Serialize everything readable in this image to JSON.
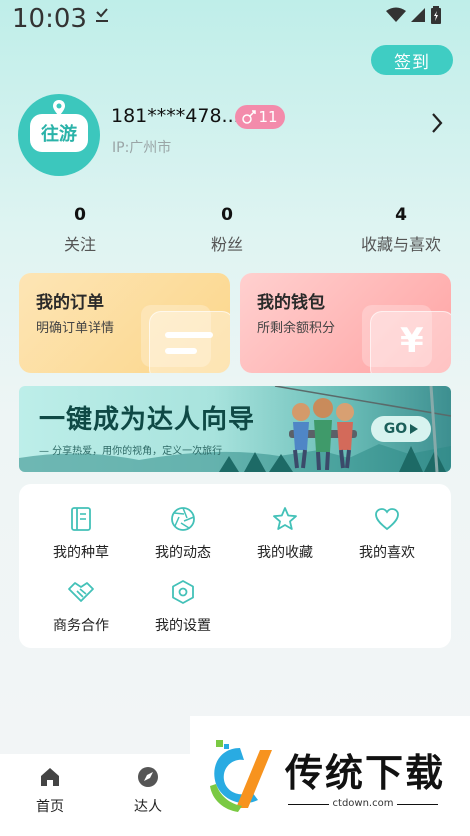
{
  "status_bar": {
    "time": "10:03"
  },
  "header": {
    "signin_label": "签到"
  },
  "profile": {
    "avatar_text": "往游",
    "phone": "181****478...",
    "level": "11",
    "ip": "IP:广州市"
  },
  "stats": [
    {
      "value": "0",
      "label": "关注"
    },
    {
      "value": "0",
      "label": "粉丝"
    },
    {
      "value": "4",
      "label": "收藏与喜欢"
    }
  ],
  "cards": {
    "order": {
      "title": "我的订单",
      "subtitle": "明确订单详情"
    },
    "wallet": {
      "title": "我的钱包",
      "subtitle": "所剩余额积分",
      "symbol": "¥"
    }
  },
  "banner": {
    "title": "一键成为达人向导",
    "subtitle": "— 分享热爱，用你的视角，定义一次旅行",
    "go_label": "GO"
  },
  "menu": [
    {
      "label": "我的种草",
      "icon": "notebook-icon"
    },
    {
      "label": "我的动态",
      "icon": "aperture-icon"
    },
    {
      "label": "我的收藏",
      "icon": "star-icon"
    },
    {
      "label": "我的喜欢",
      "icon": "heart-icon"
    },
    {
      "label": "商务合作",
      "icon": "handshake-icon"
    },
    {
      "label": "我的设置",
      "icon": "settings-hexagon-icon"
    }
  ],
  "bottom_nav": [
    {
      "label": "首页",
      "icon": "home-icon"
    },
    {
      "label": "达人",
      "icon": "compass-icon"
    }
  ],
  "watermark": {
    "text": "传统下载",
    "url": "ctdown.com"
  },
  "colors": {
    "accent": "#3fcdc3",
    "level_badge": "#f38bab",
    "order_card": "#fcd68a",
    "wallet_card": "#ffa3a3"
  }
}
